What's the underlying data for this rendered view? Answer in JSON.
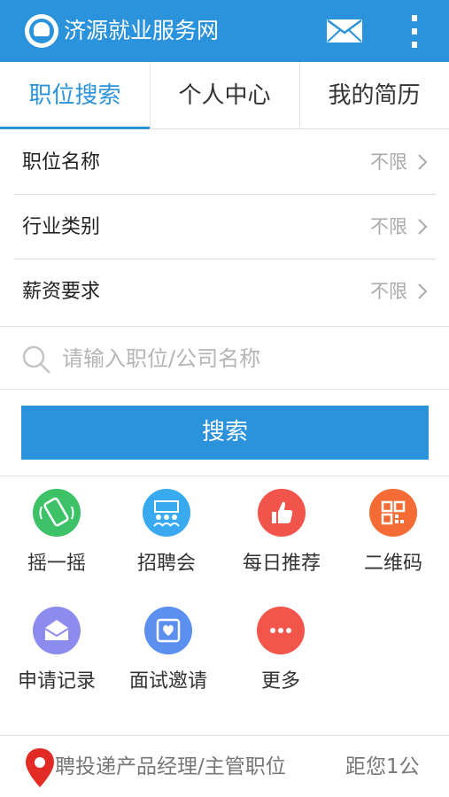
{
  "header": {
    "title": "济源就业服务网",
    "logo_icon": "city-emblem-icon",
    "mail_icon": "mail-icon",
    "menu_icon": "more-vertical-icon",
    "color": "#2b93dc"
  },
  "tabs": [
    {
      "label": "职位搜索",
      "active": true
    },
    {
      "label": "个人中心",
      "active": false
    },
    {
      "label": "我的简历",
      "active": false
    }
  ],
  "filters": [
    {
      "label": "职位名称",
      "value": "不限"
    },
    {
      "label": "行业类别",
      "value": "不限"
    },
    {
      "label": "薪资要求",
      "value": "不限"
    }
  ],
  "search": {
    "placeholder": "请输入职位/公司名称",
    "value": "",
    "button_label": "搜索"
  },
  "shortcuts": [
    {
      "label": "摇一摇",
      "icon": "phone-shake-icon",
      "color": "#3ec268"
    },
    {
      "label": "招聘会",
      "icon": "job-fair-icon",
      "color": "#3aaaf0"
    },
    {
      "label": "每日推荐",
      "icon": "thumbs-up-icon",
      "color": "#f0544a"
    },
    {
      "label": "二维码",
      "icon": "qr-code-icon",
      "color": "#f56b35"
    },
    {
      "label": "申请记录",
      "icon": "envelope-icon",
      "color": "#8c8cef"
    },
    {
      "label": "面试邀请",
      "icon": "invitation-icon",
      "color": "#5b8ff0"
    },
    {
      "label": "更多",
      "icon": "more-dots-icon",
      "color": "#f2564a"
    }
  ],
  "footer": {
    "pin_icon": "location-pin-icon",
    "marquee_text": "聘投递产品经理/主管职位",
    "distance_text": "距您1公"
  }
}
